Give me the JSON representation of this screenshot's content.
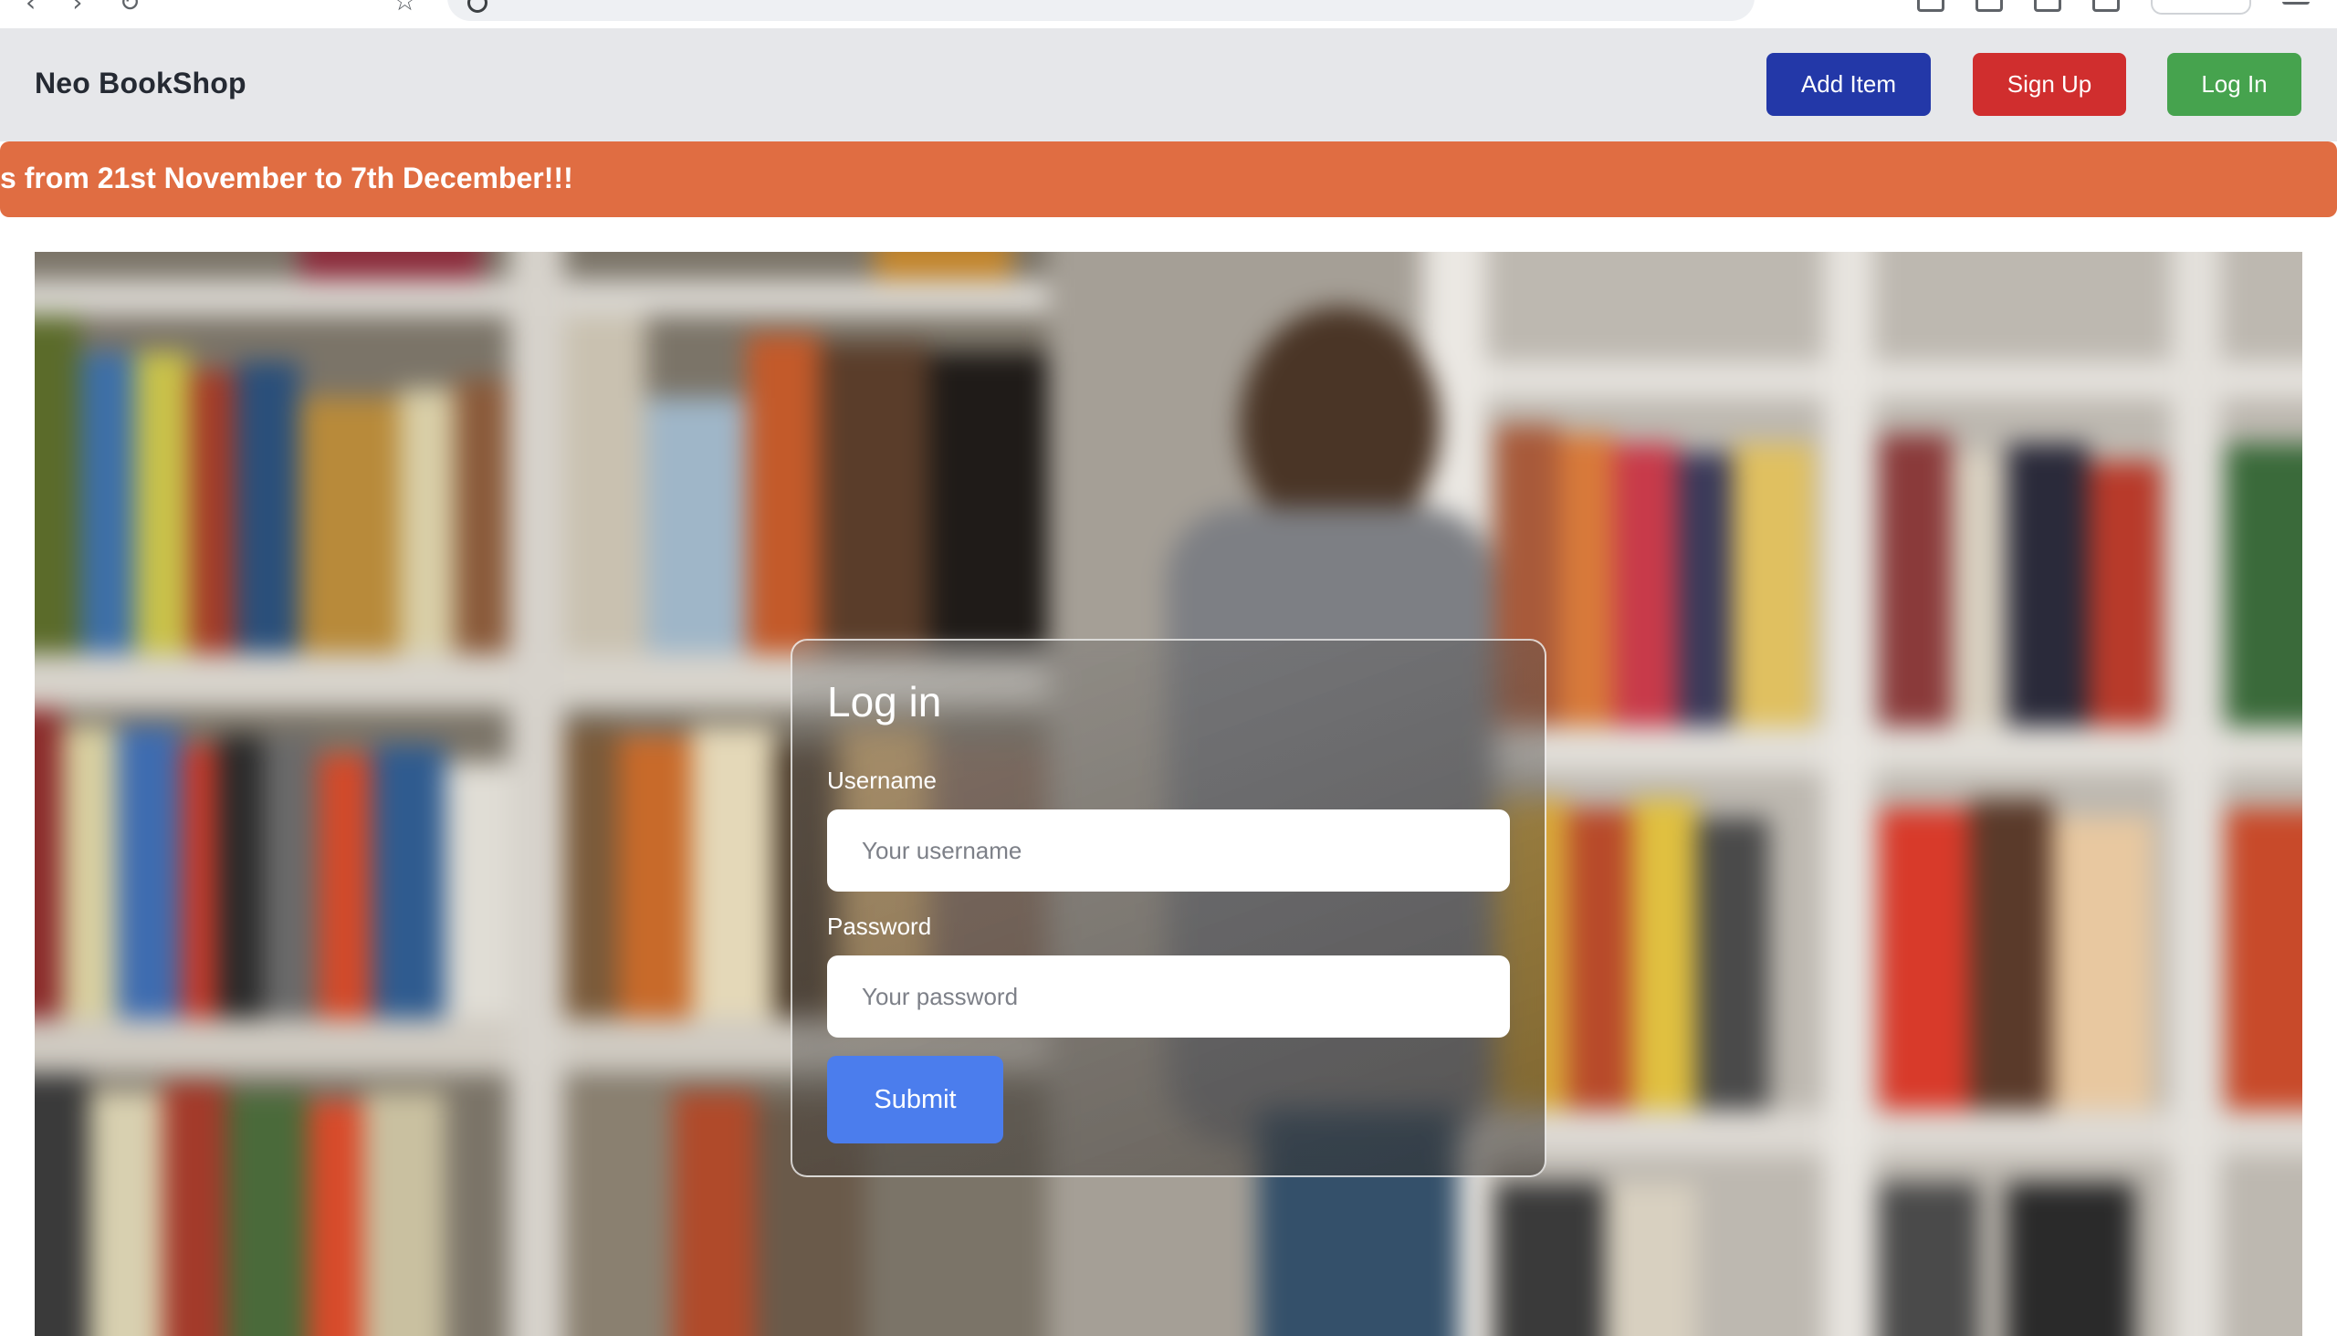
{
  "navbar": {
    "brand": "Neo BookShop",
    "add_item_label": "Add Item",
    "sign_up_label": "Sign Up",
    "log_in_label": "Log In",
    "colors": {
      "background": "#e6e7ea",
      "add_item": "#2338a8",
      "sign_up": "#d02e2e",
      "log_in": "#46a34e"
    }
  },
  "banner": {
    "text": "s from 21st November to 7th December!!!",
    "color": "#e06d42"
  },
  "login_form": {
    "title": "Log in",
    "username_label": "Username",
    "username_placeholder": "Your username",
    "username_value": "",
    "password_label": "Password",
    "password_placeholder": "Your password",
    "password_value": "",
    "submit_label": "Submit",
    "submit_color": "#4b7ded"
  }
}
